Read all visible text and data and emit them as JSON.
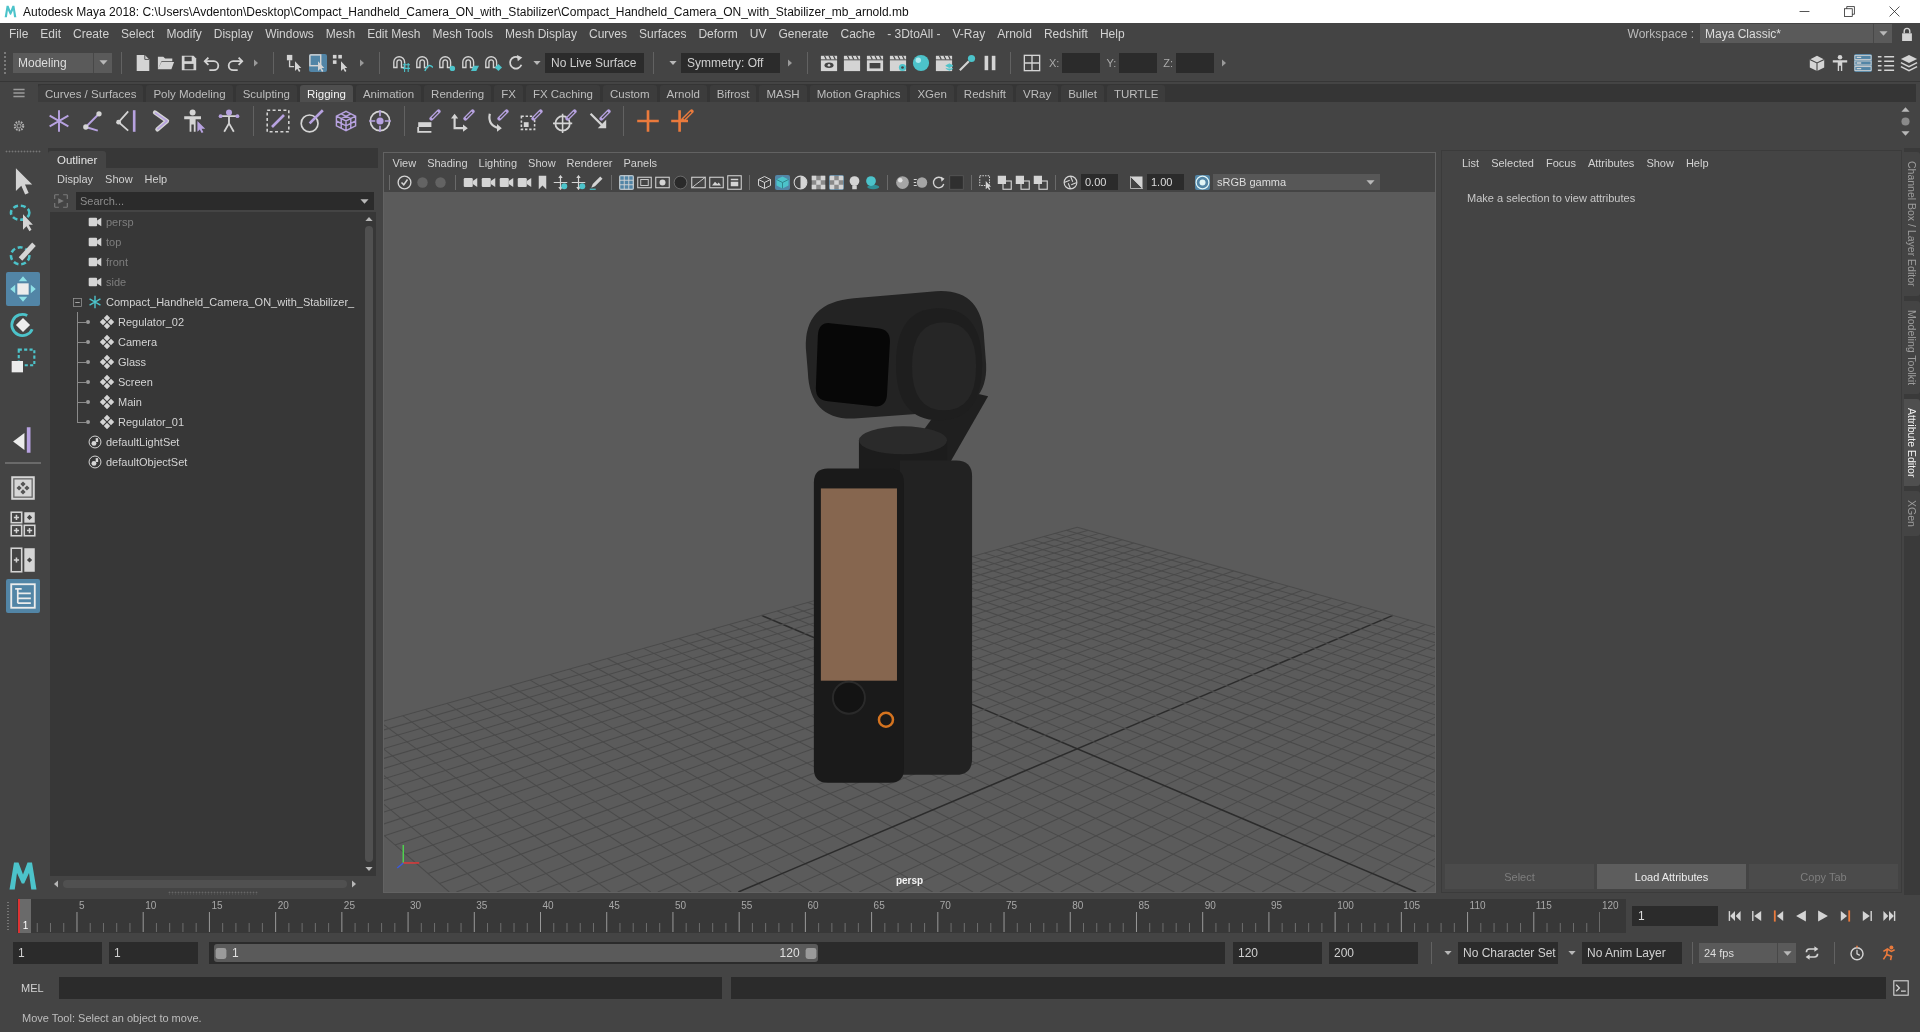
{
  "window": {
    "title": "Autodesk Maya 2018: C:\\Users\\Avdenton\\Desktop\\Compact_Handheld_Camera_ON_with_Stabilizer\\Compact_Handheld_Camera_ON_with_Stabilizer_mb_arnold.mb"
  },
  "menu_bar": {
    "items": [
      "File",
      "Edit",
      "Create",
      "Select",
      "Modify",
      "Display",
      "Windows",
      "Mesh",
      "Edit Mesh",
      "Mesh Tools",
      "Mesh Display",
      "Curves",
      "Surfaces",
      "Deform",
      "UV",
      "Generate",
      "Cache",
      "- 3DtoAll -",
      "V-Ray",
      "Arnold",
      "Redshift",
      "Help"
    ],
    "workspace_label": "Workspace :",
    "workspace": "Maya Classic*"
  },
  "status_line": {
    "menu_set": "Modeling",
    "selection_modes": [
      {
        "kind": "hierarchy",
        "selected": false
      },
      {
        "kind": "object",
        "selected": true
      },
      {
        "kind": "component",
        "selected": false
      }
    ],
    "live_surface": "No Live Surface",
    "symmetry": "Symmetry: Off",
    "coordinates": [
      "X:",
      "Y:",
      "Z:"
    ],
    "panel_toggles": [
      {
        "kind": "toolkit",
        "on": false
      },
      {
        "kind": "character",
        "on": false
      },
      {
        "kind": "attributes",
        "on": true
      },
      {
        "kind": "settings",
        "on": false
      },
      {
        "kind": "layers",
        "on": false
      }
    ]
  },
  "shelf": {
    "tabs": [
      {
        "label": "Curves / Surfaces",
        "selected": false
      },
      {
        "label": "Poly Modeling",
        "selected": false
      },
      {
        "label": "Sculpting",
        "selected": false
      },
      {
        "label": "Rigging",
        "selected": true
      },
      {
        "label": "Animation",
        "selected": false
      },
      {
        "label": "Rendering",
        "selected": false
      },
      {
        "label": "FX",
        "selected": false
      },
      {
        "label": "FX Caching",
        "selected": false
      },
      {
        "label": "Custom",
        "selected": false
      },
      {
        "label": "Arnold",
        "selected": false
      },
      {
        "label": "Bifrost",
        "selected": false
      },
      {
        "label": "MASH",
        "selected": false
      },
      {
        "label": "Motion Graphics",
        "selected": false
      },
      {
        "label": "XGen",
        "selected": false
      },
      {
        "label": "Redshift",
        "selected": false
      },
      {
        "label": "VRay",
        "selected": false
      },
      {
        "label": "Bullet",
        "selected": false
      },
      {
        "label": "TURTLE",
        "selected": false
      }
    ]
  },
  "tool_box": {
    "tools": [
      {
        "kind": "select",
        "selected": false
      },
      {
        "kind": "lasso",
        "selected": false
      },
      {
        "kind": "paint",
        "selected": false
      },
      {
        "kind": "move",
        "selected": true
      },
      {
        "kind": "rotate",
        "selected": false
      },
      {
        "kind": "scale",
        "selected": false
      },
      {
        "kind": "manipulator",
        "selected": false
      }
    ],
    "layouts": [
      {
        "kind": "single",
        "selected": false
      },
      {
        "kind": "quad",
        "selected": false
      },
      {
        "kind": "split",
        "selected": false
      },
      {
        "kind": "outliner",
        "selected": true
      }
    ]
  },
  "outliner": {
    "tab": "Outliner",
    "menu": [
      "Display",
      "Show",
      "Help"
    ],
    "search": {
      "placeholder": "Search..."
    },
    "items": [
      {
        "label": "persp",
        "kind": "camera",
        "hidden": true
      },
      {
        "label": "top",
        "kind": "camera",
        "hidden": true
      },
      {
        "label": "front",
        "kind": "camera",
        "hidden": true
      },
      {
        "label": "side",
        "kind": "camera",
        "hidden": true
      },
      {
        "label": "Compact_Handheld_Camera_ON_with_Stabilizer_",
        "kind": "group",
        "hidden": false,
        "expanded": true,
        "children": [
          {
            "label": "Regulator_02",
            "kind": "mesh",
            "hidden": false
          },
          {
            "label": "Camera",
            "kind": "mesh",
            "hidden": false
          },
          {
            "label": "Glass",
            "kind": "mesh",
            "hidden": false
          },
          {
            "label": "Screen",
            "kind": "mesh",
            "hidden": false
          },
          {
            "label": "Main",
            "kind": "mesh",
            "hidden": false
          },
          {
            "label": "Regulator_01",
            "kind": "mesh",
            "hidden": false
          }
        ]
      },
      {
        "label": "defaultLightSet",
        "kind": "set",
        "hidden": false
      },
      {
        "label": "defaultObjectSet",
        "kind": "set",
        "hidden": false
      }
    ]
  },
  "viewport": {
    "menu": [
      "View",
      "Shading",
      "Lighting",
      "Show",
      "Renderer",
      "Panels"
    ],
    "toolbar": [
      [
        {
          "kind": "check",
          "on": false
        },
        {
          "kind": "dot",
          "on": false
        },
        {
          "kind": "dot",
          "on": false
        }
      ],
      [
        {
          "kind": "camera",
          "on": false
        },
        {
          "kind": "camera",
          "on": false
        },
        {
          "kind": "camera",
          "on": false
        },
        {
          "kind": "camera",
          "on": false
        },
        {
          "kind": "flag",
          "on": false
        },
        {
          "kind": "pan",
          "on": false
        },
        {
          "kind": "pan",
          "on": false
        },
        {
          "kind": "pen",
          "on": false
        }
      ],
      [
        {
          "kind": "grid",
          "on": true
        },
        {
          "kind": "gate",
          "on": false
        },
        {
          "kind": "ring",
          "on": false
        },
        {
          "kind": "ball",
          "on": false
        },
        {
          "kind": "chart",
          "on": false
        },
        {
          "kind": "safe",
          "on": false
        },
        {
          "kind": "framebar",
          "on": false
        }
      ],
      [
        {
          "kind": "wire",
          "on": false
        },
        {
          "kind": "cube",
          "on": true
        },
        {
          "kind": "half",
          "on": false
        },
        {
          "kind": "checker",
          "on": false
        },
        {
          "kind": "checker",
          "on": true
        },
        {
          "kind": "bulb",
          "on": false
        },
        {
          "kind": "shadow",
          "on": false
        }
      ],
      [
        {
          "kind": "sphere",
          "on": false
        },
        {
          "kind": "blur",
          "on": false
        },
        {
          "kind": "cycle",
          "on": false
        },
        {
          "kind": "box",
          "on": false
        }
      ],
      [
        {
          "kind": "isolate",
          "on": false
        },
        {
          "kind": "xray",
          "on": false
        },
        {
          "kind": "xray",
          "on": false
        },
        {
          "kind": "xray",
          "on": false
        }
      ]
    ],
    "exposure": "0.00",
    "gamma": "1.00",
    "color_management": {
      "on": true,
      "view_transform": "sRGB gamma"
    },
    "camera": "persp"
  },
  "attribute_editor": {
    "menu": [
      "List",
      "Selected",
      "Focus",
      "Attributes",
      "Show",
      "Help"
    ],
    "message": "Make a selection to view attributes",
    "buttons": [
      {
        "label": "Select",
        "disabled": true
      },
      {
        "label": "Load Attributes",
        "disabled": false
      },
      {
        "label": "Copy Tab",
        "disabled": true
      }
    ]
  },
  "side_tabs": [
    {
      "label": "Channel Box / Layer Editor",
      "selected": false
    },
    {
      "label": "Modeling Toolkit",
      "selected": false
    },
    {
      "label": "Attribute Editor",
      "selected": true
    },
    {
      "label": "XGen",
      "selected": false
    }
  ],
  "time_slider": {
    "ticks": [
      "5",
      "10",
      "15",
      "20",
      "25",
      "30",
      "35",
      "40",
      "45",
      "50",
      "55",
      "60",
      "65",
      "70",
      "75",
      "80",
      "85",
      "90",
      "95",
      "100",
      "105",
      "110",
      "115",
      "120"
    ],
    "marker": "1",
    "level": 0,
    "current_frame": "1"
  },
  "range_slider": {
    "animation_start": "1",
    "playback_start": "1",
    "range_start": "1",
    "range_end": "120",
    "level": 0.6,
    "playback_end": "120",
    "animation_end": "200",
    "character_set": "No Character Set",
    "anim_layer": "No Anim Layer",
    "fps": "24 fps"
  },
  "command_line": {
    "language": "MEL"
  },
  "help_line": "Move Tool: Select an object to move."
}
